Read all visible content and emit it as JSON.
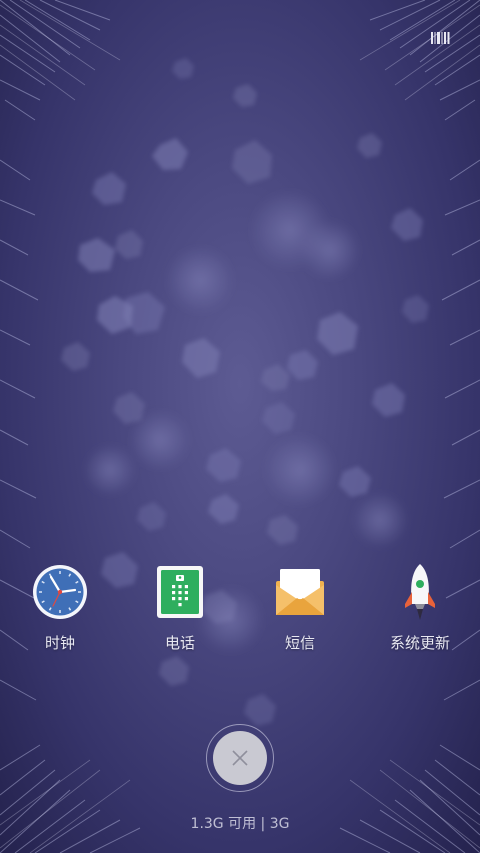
{
  "status_bar": {
    "icon": "barcode-icon"
  },
  "apps": [
    {
      "label": "时钟",
      "icon": "clock-icon"
    },
    {
      "label": "电话",
      "icon": "phone-icon"
    },
    {
      "label": "短信",
      "icon": "message-icon"
    },
    {
      "label": "系统更新",
      "icon": "rocket-icon"
    }
  ],
  "close_button": {
    "icon": "close-icon"
  },
  "memory": {
    "text": "1.3G 可用 | 3G"
  },
  "colors": {
    "background": "#4a4880",
    "phone_green": "#2eae5e",
    "message_orange": "#f0b24f",
    "clock_blue": "#3f6fb7"
  }
}
